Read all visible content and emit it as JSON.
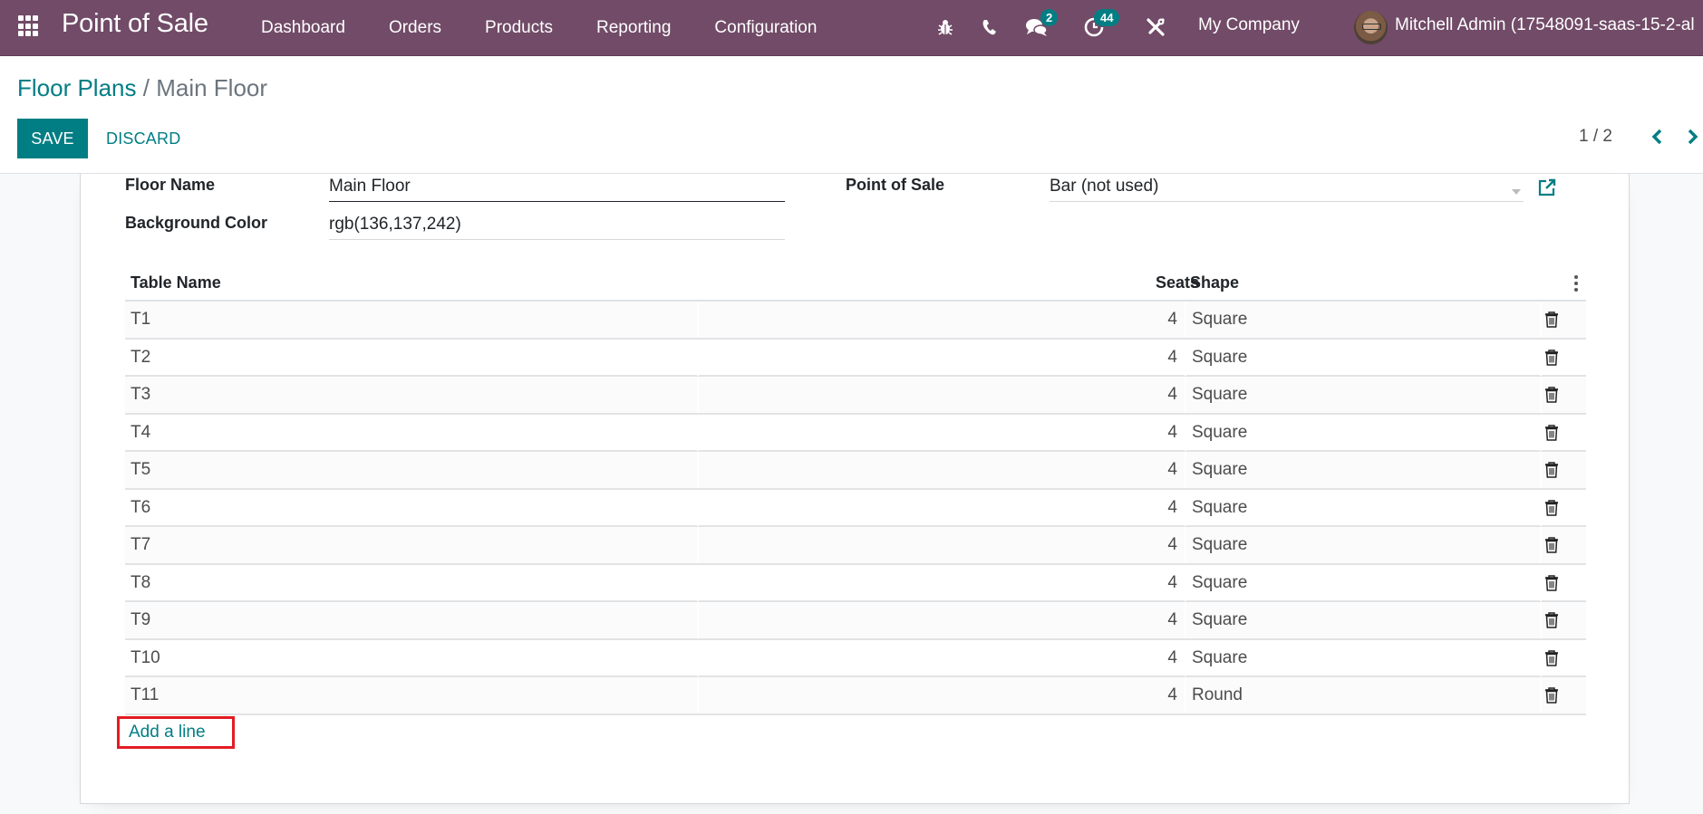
{
  "navbar": {
    "app_title": "Point of Sale",
    "menu": [
      {
        "label": "Dashboard"
      },
      {
        "label": "Orders"
      },
      {
        "label": "Products"
      },
      {
        "label": "Reporting"
      },
      {
        "label": "Configuration"
      }
    ],
    "systray": {
      "debug_icon": "bug-icon",
      "phone_icon": "phone-icon",
      "messages_icon": "chat-icon",
      "messages_count": "2",
      "activities_icon": "clock-icon",
      "activities_count": "44",
      "tools_icon": "tools-icon",
      "company": "My Company",
      "user_name": "Mitchell Admin (17548091-saas-15-2-al"
    },
    "colors": {
      "brand": "#714b67",
      "badge": "#017e84"
    }
  },
  "control_panel": {
    "breadcrumb": {
      "parent": "Floor Plans",
      "separator": "/",
      "current": "Main Floor"
    },
    "save_label": "SAVE",
    "discard_label": "DISCARD",
    "pager": {
      "value": "1 / 2"
    },
    "colors": {
      "primary": "#017e84"
    }
  },
  "form": {
    "floor_name": {
      "label": "Floor Name",
      "value": "Main Floor"
    },
    "background_color": {
      "label": "Background Color",
      "value": "rgb(136,137,242)"
    },
    "point_of_sale": {
      "label": "Point of Sale",
      "value": "Bar (not used)"
    }
  },
  "tables": {
    "headers": {
      "name": "Table Name",
      "seats": "Seats",
      "shape": "Shape"
    },
    "rows": [
      {
        "name": "T1",
        "seats": "4",
        "shape": "Square"
      },
      {
        "name": "T2",
        "seats": "4",
        "shape": "Square"
      },
      {
        "name": "T3",
        "seats": "4",
        "shape": "Square"
      },
      {
        "name": "T4",
        "seats": "4",
        "shape": "Square"
      },
      {
        "name": "T5",
        "seats": "4",
        "shape": "Square"
      },
      {
        "name": "T6",
        "seats": "4",
        "shape": "Square"
      },
      {
        "name": "T7",
        "seats": "4",
        "shape": "Square"
      },
      {
        "name": "T8",
        "seats": "4",
        "shape": "Square"
      },
      {
        "name": "T9",
        "seats": "4",
        "shape": "Square"
      },
      {
        "name": "T10",
        "seats": "4",
        "shape": "Square"
      },
      {
        "name": "T11",
        "seats": "4",
        "shape": "Round"
      }
    ],
    "add_line_label": "Add a line",
    "highlight_color": "#e31b23"
  }
}
